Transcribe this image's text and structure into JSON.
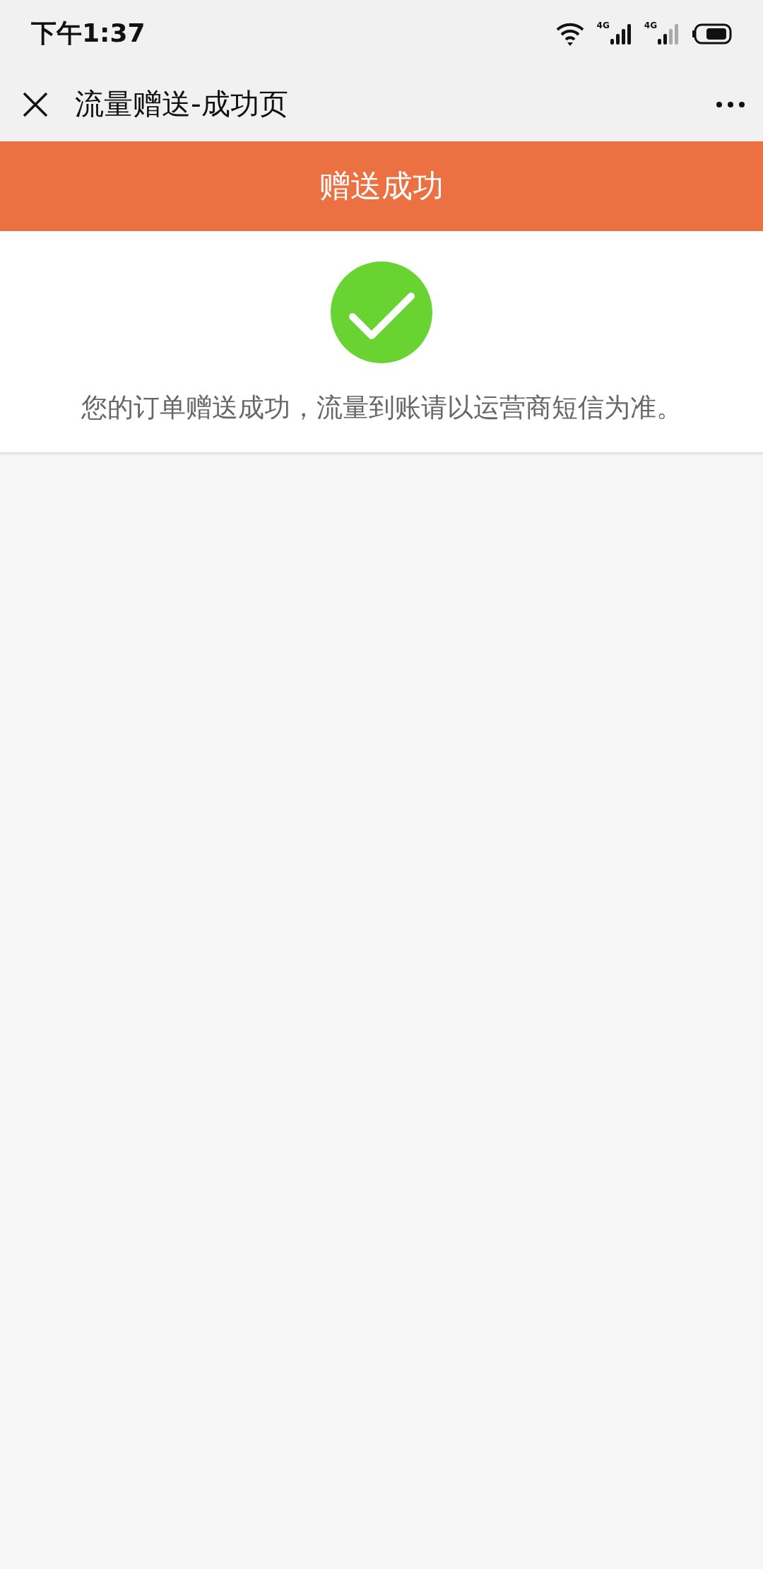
{
  "status_bar": {
    "time": "下午1:37",
    "signals": [
      {
        "label": "4G",
        "bars_filled": true
      },
      {
        "label": "4G",
        "bars_filled": false
      }
    ]
  },
  "nav": {
    "title": "流量赠送-成功页"
  },
  "banner": {
    "title": "赠送成功"
  },
  "result": {
    "message": "您的订单赠送成功，流量到账请以运营商短信为准。"
  }
}
